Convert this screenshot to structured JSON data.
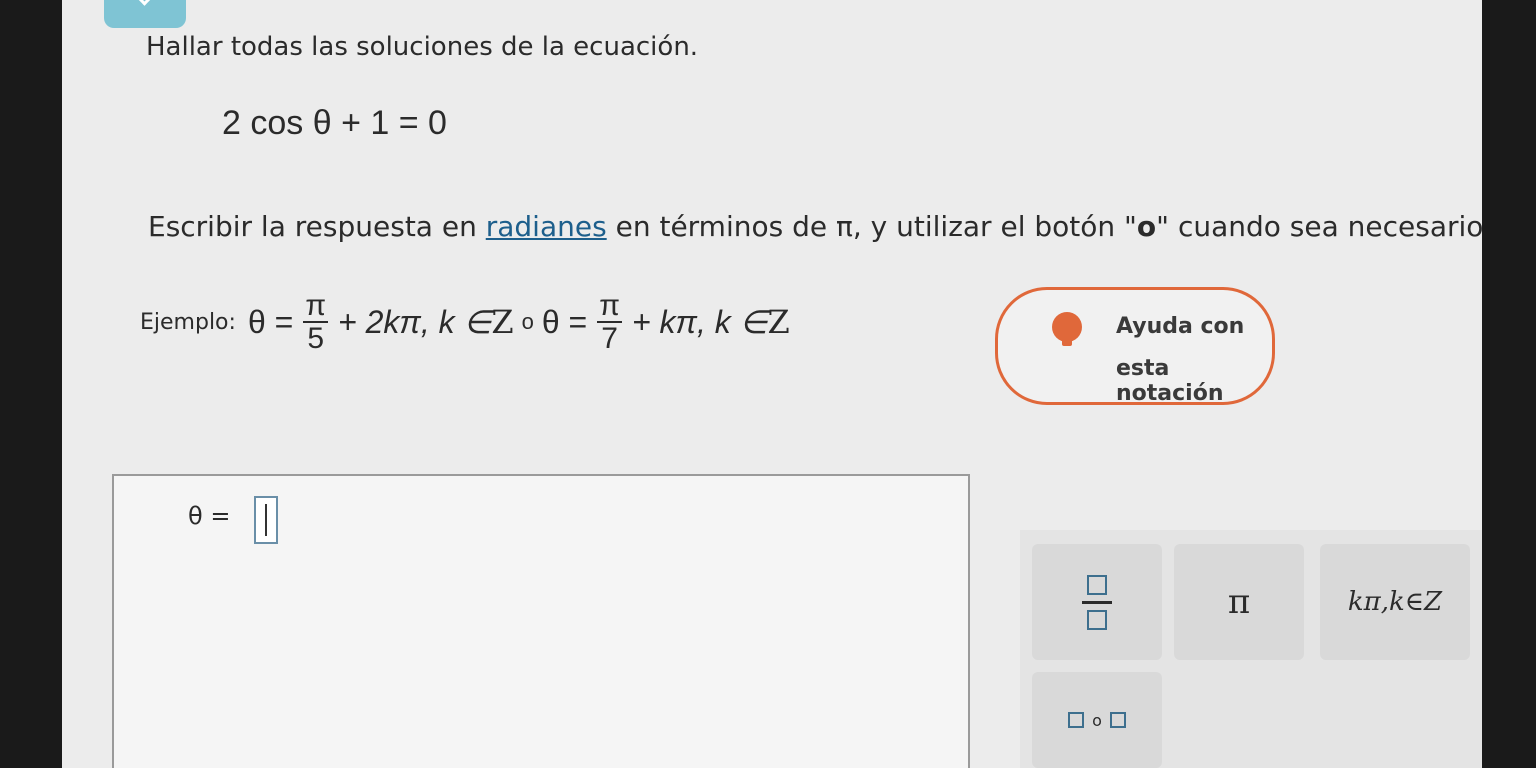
{
  "instruction": "Hallar todas las soluciones de la ecuación.",
  "equation": "2 cos θ + 1 = 0",
  "write": {
    "prefix": "Escribir la respuesta en ",
    "link": "radianes",
    "middle": " en términos de π, y utilizar el botón \"",
    "button_word": "o",
    "suffix": "\" cuando sea necesario"
  },
  "example": {
    "label": "Ejemplo:",
    "theta1": "θ =",
    "frac1_num": "π",
    "frac1_den": "5",
    "term1": "+ 2kπ, k ∈ ",
    "set1": "Z",
    "or_word": "o",
    "theta2": "θ =",
    "frac2_num": "π",
    "frac2_den": "7",
    "term2": "+ kπ, k ∈ ",
    "set2": "Z"
  },
  "help": {
    "line1": "Ayuda con",
    "line2": "esta notación"
  },
  "answer": {
    "label": "θ ="
  },
  "keypad": {
    "pi_label": "π",
    "kpi_label": "kπ,k∈Z",
    "or_label": "o"
  }
}
